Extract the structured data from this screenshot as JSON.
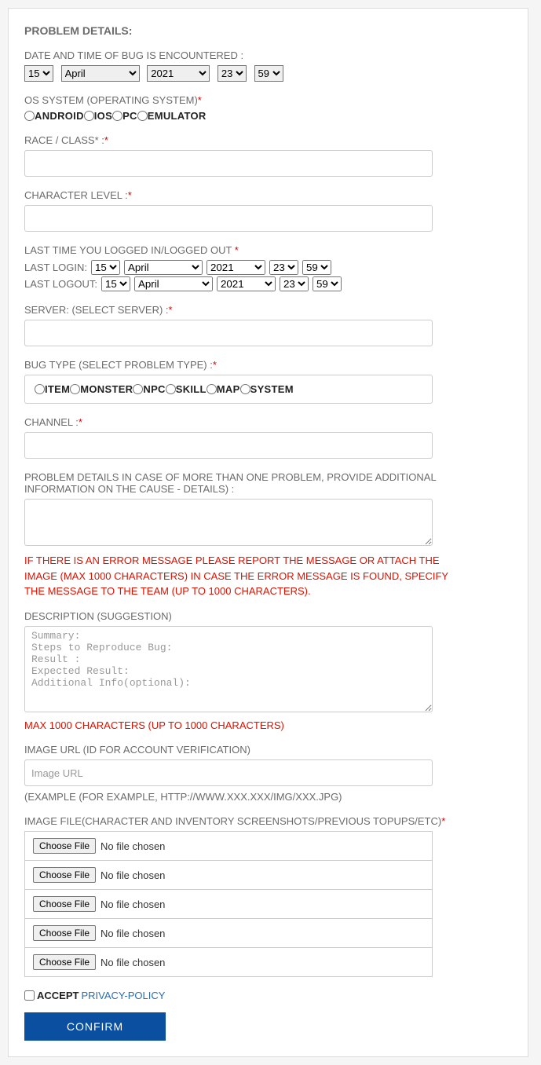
{
  "title": "PROBLEM DETAILS:",
  "date_label": "DATE AND TIME OF BUG IS ENCOUNTERED :",
  "date": {
    "day": "15",
    "month": "April",
    "year": "2021",
    "hour": "23",
    "min": "59"
  },
  "os_label": "OS SYSTEM (OPERATING SYSTEM)",
  "os_options": {
    "a": "ANDROID",
    "b": "IOS",
    "c": "PC",
    "d": "EMULATOR"
  },
  "race_label": "RACE / CLASS* :",
  "charlvl_label": "CHARACTER LEVEL :",
  "lastlog_label": "LAST TIME YOU LOGGED IN/LOGGED OUT ",
  "login_label": "LAST LOGIN:",
  "logout_label": "LAST LOGOUT:",
  "login": {
    "day": "15",
    "month": "April",
    "year": "2021",
    "hour": "23",
    "min": "59"
  },
  "logout": {
    "day": "15",
    "month": "April",
    "year": "2021",
    "hour": "23",
    "min": "59"
  },
  "server_label": "SERVER: (SELECT SERVER) :",
  "bugtype_label": "BUG TYPE (SELECT PROBLEM TYPE) :",
  "bugtype_options": {
    "a": "ITEM",
    "b": "MONSTER",
    "c": "NPC",
    "d": "SKILL",
    "e": "MAP",
    "f": "SYSTEM"
  },
  "channel_label": "CHANNEL :",
  "details_label": "PROBLEM DETAILS IN CASE OF MORE THAN ONE PROBLEM, PROVIDE ADDITIONAL INFORMATION ON THE CAUSE - DETAILS) :",
  "error_note": "IF THERE IS AN ERROR MESSAGE PLEASE REPORT THE MESSAGE OR ATTACH THE IMAGE (MAX 1000 CHARACTERS) IN CASE THE ERROR MESSAGE IS FOUND, SPECIFY THE MESSAGE TO THE TEAM (UP TO 1000 CHARACTERS).",
  "desc_label": "DESCRIPTION (SUGGESTION)",
  "desc_placeholder": "Summary:\nSteps to Reproduce Bug:\nResult :\nExpected Result:\nAdditional Info(optional):",
  "max_note": "MAX 1000 CHARACTERS (UP TO 1000 CHARACTERS)",
  "imgurl_label": "IMAGE URL (ID FOR ACCOUNT VERIFICATION)",
  "imgurl_placeholder": "Image URL",
  "imgurl_example": "(EXAMPLE (FOR EXAMPLE, HTTP://WWW.XXX.XXX/IMG/XXX.JPG)",
  "imgfile_label": "IMAGE FILE(CHARACTER AND INVENTORY SCREENSHOTS/PREVIOUS TOPUPS/ETC)",
  "choose_file": "Choose File",
  "no_file": "No file chosen",
  "accept_label": "ACCEPT",
  "privacy_link": "PRIVACY-POLICY",
  "confirm": "CONFIRM",
  "star": "*"
}
